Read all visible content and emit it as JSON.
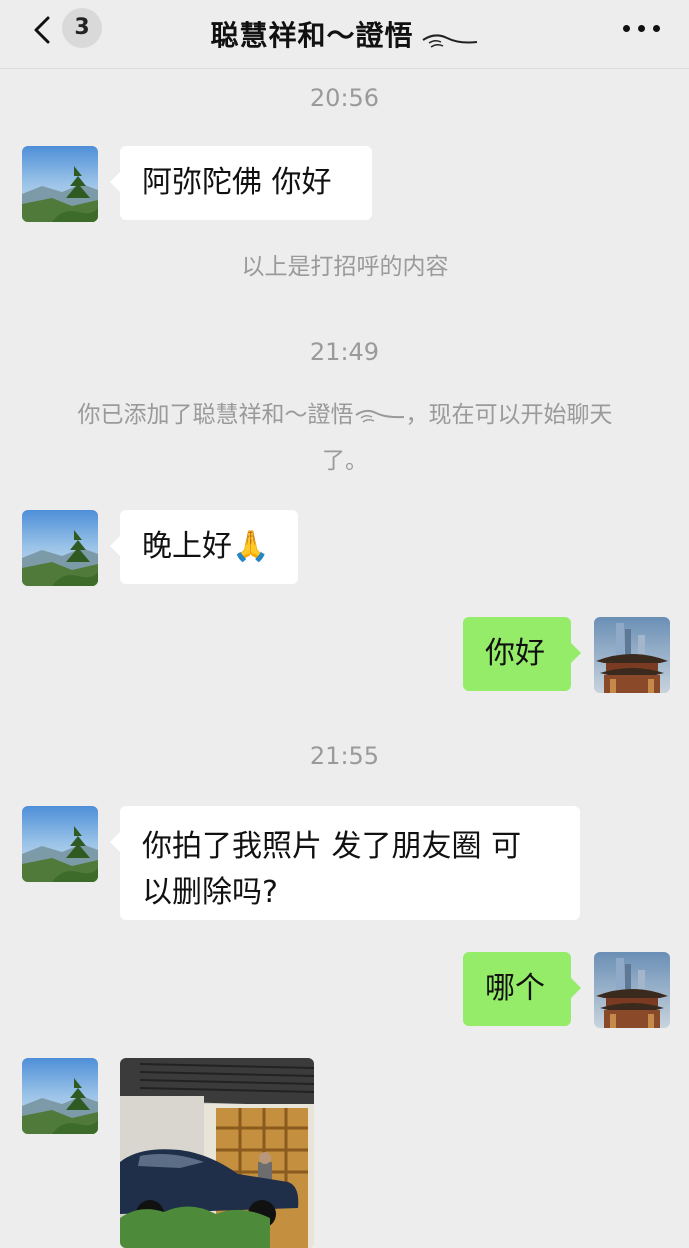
{
  "header": {
    "badge_count": "3",
    "title": "聪慧祥和～證悟"
  },
  "messages": [
    {
      "type": "time",
      "text": "20:56"
    },
    {
      "type": "incoming",
      "text": "阿弥陀佛  你好"
    },
    {
      "type": "system",
      "text": "以上是打招呼的内容"
    },
    {
      "type": "time",
      "text": "21:49"
    },
    {
      "type": "system",
      "text_before": "你已添加了聪慧祥和～證悟",
      "text_after": "，现在可以开始聊天了。"
    },
    {
      "type": "incoming",
      "text": "晚上好🙏"
    },
    {
      "type": "outgoing",
      "text": "你好"
    },
    {
      "type": "time",
      "text": "21:55"
    },
    {
      "type": "incoming",
      "text_line1": "你拍了我照片  发了朋友圈  可",
      "text_line2": "以删除吗?"
    },
    {
      "type": "outgoing",
      "text": "哪个"
    },
    {
      "type": "incoming_image"
    }
  ],
  "colors": {
    "background": "#ededed",
    "outgoing_bubble": "#95ec69",
    "incoming_bubble": "#ffffff",
    "meta_text": "#9a9a9a"
  },
  "icons": [
    "chevron-left-icon",
    "more-dots-icon",
    "landscape-avatar",
    "temple-avatar"
  ]
}
